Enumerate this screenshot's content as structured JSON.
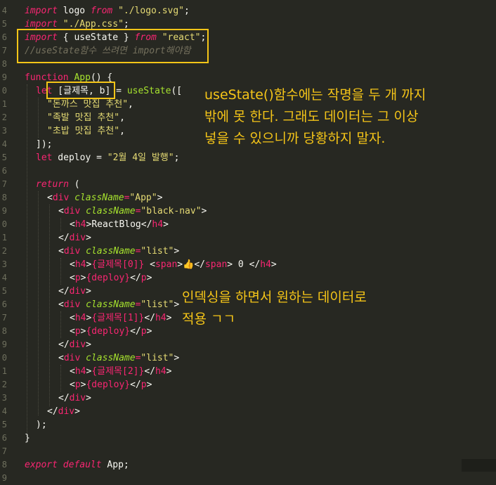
{
  "line_numbers": [
    "4",
    "5",
    "6",
    "7",
    "8",
    "9",
    "0",
    "1",
    "2",
    "3",
    "4",
    "5",
    "6",
    "7",
    "8",
    "9",
    "0",
    "1",
    "2",
    "3",
    "4",
    "5",
    "6",
    "7",
    "8",
    "9",
    "0",
    "1",
    "2",
    "3",
    "4",
    "5",
    "6",
    "7",
    "8",
    "9"
  ],
  "code": {
    "l4_kw": "import",
    "l4_mid": " logo ",
    "l4_from": "from",
    "l4_str": "\"./logo.svg\"",
    "l4_end": ";",
    "l5_kw": "import",
    "l5_str": "\"./App.css\"",
    "l5_end": ";",
    "l6_kw": "import",
    "l6_mid": " { useState } ",
    "l6_from": "from",
    "l6_str": "\"react\"",
    "l6_end": ";",
    "l7_comment": "//useState함수 쓰려면 import해야함",
    "l9_kw": "function",
    "l9_fn": "App",
    "l9_rest": "() {",
    "l10_kw": "let",
    "l10_mid": " [글제목, b] = ",
    "l10_fn": "useState",
    "l10_rest": "([",
    "l11_str": "\"돈까스 맛집 추천\"",
    "l11_end": ",",
    "l12_str": "\"족발 맛집 추천\"",
    "l12_end": ",",
    "l13_str": "\"초밥 맛집 추천\"",
    "l13_end": ",",
    "l14": "]);",
    "l15_kw": "let",
    "l15_mid": " deploy = ",
    "l15_str": "\"2월 4일 발행\"",
    "l15_end": ";",
    "l17_kw": "return",
    "l17_end": " (",
    "l18_open": "<",
    "l18_tag": "div",
    "l18_attr": "className",
    "l18_eq": "=",
    "l18_str": "\"App\"",
    "l18_close": ">",
    "l19_open": "<",
    "l19_tag": "div",
    "l19_attr": "className",
    "l19_eq": "=",
    "l19_str": "\"black-nav\"",
    "l19_close": ">",
    "l20_o1": "<",
    "l20_tag": "h4",
    "l20_c1": ">",
    "l20_text": "ReactBlog",
    "l20_o2": "</",
    "l20_tag2": "h4",
    "l20_c2": ">",
    "l21_o": "</",
    "l21_tag": "div",
    "l21_c": ">",
    "l22_open": "<",
    "l22_tag": "div",
    "l22_attr": "className",
    "l22_eq": "=",
    "l22_str": "\"list\"",
    "l22_close": ">",
    "l23_o1": "<",
    "l23_tag": "h4",
    "l23_c1": ">",
    "l23_expr": "{글제목[0]}",
    "l23_sp": " ",
    "l23_o2": "<",
    "l23_span": "span",
    "l23_c2": ">",
    "l23_emoji": "👍",
    "l23_o3": "</",
    "l23_span2": "span",
    "l23_c3": ">",
    "l23_zero": " 0 ",
    "l23_o4": "</",
    "l23_tag2": "h4",
    "l23_c4": ">",
    "l24_o1": "<",
    "l24_tag": "p",
    "l24_c1": ">",
    "l24_expr": "{deploy}",
    "l24_o2": "</",
    "l24_tag2": "p",
    "l24_c2": ">",
    "l25_o": "</",
    "l25_tag": "div",
    "l25_c": ">",
    "l26_open": "<",
    "l26_tag": "div",
    "l26_attr": "className",
    "l26_eq": "=",
    "l26_str": "\"list\"",
    "l26_close": ">",
    "l27_o1": "<",
    "l27_tag": "h4",
    "l27_c1": ">",
    "l27_expr": "{글제목[1]}",
    "l27_o2": "</",
    "l27_tag2": "h4",
    "l27_c2": ">",
    "l28_o1": "<",
    "l28_tag": "p",
    "l28_c1": ">",
    "l28_expr": "{deploy}",
    "l28_o2": "</",
    "l28_tag2": "p",
    "l28_c2": ">",
    "l29_o": "</",
    "l29_tag": "div",
    "l29_c": ">",
    "l30_open": "<",
    "l30_tag": "div",
    "l30_attr": "className",
    "l30_eq": "=",
    "l30_str": "\"list\"",
    "l30_close": ">",
    "l31_o1": "<",
    "l31_tag": "h4",
    "l31_c1": ">",
    "l31_expr": "{글제목[2]}",
    "l31_o2": "</",
    "l31_tag2": "h4",
    "l31_c2": ">",
    "l32_o1": "<",
    "l32_tag": "p",
    "l32_c1": ">",
    "l32_expr": "{deploy}",
    "l32_o2": "</",
    "l32_tag2": "p",
    "l32_c2": ">",
    "l33_o": "</",
    "l33_tag": "div",
    "l33_c": ">",
    "l34_o": "</",
    "l34_tag": "div",
    "l34_c": ">",
    "l35": ");",
    "l36": "}",
    "l38_kw1": "export",
    "l38_kw2": "default",
    "l38_rest": " App;"
  },
  "annotations": {
    "note1": "useState()함수에는 작명을 두 개 까지\n밖에 못 한다. 그래도 데이터는 그 이상\n넣을 수 있으니까 당황하지 말자.",
    "note2": "인덱싱을 하면서 원하는 데이터로\n적용 ㄱㄱ"
  },
  "colors": {
    "background": "#272822",
    "highlight_box": "#f5c518",
    "annotation_text": "#f5c518"
  }
}
